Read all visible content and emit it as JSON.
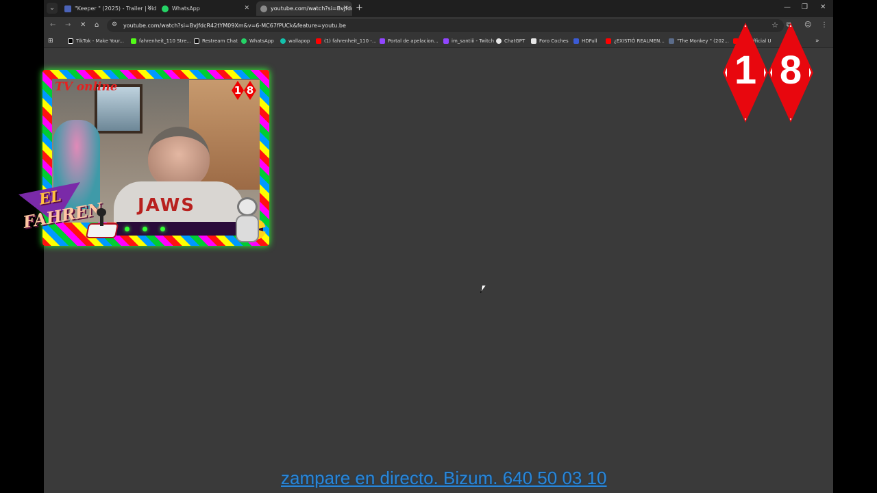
{
  "browser": {
    "tabs": [
      {
        "label": "\"Keeper \" (2025) - Trailer | vide",
        "favicon": "hdfull-icon",
        "active": false
      },
      {
        "label": "WhatsApp",
        "favicon": "whatsapp-icon",
        "active": false
      },
      {
        "label": "youtube.com/watch?si=BvJfdc",
        "favicon": "loading-icon",
        "active": true
      }
    ],
    "url": "youtube.com/watch?si=BvJfdcR42tYM09Xm&v=6-MC67fPUCk&feature=youtu.be",
    "bookmarks": [
      {
        "label": "TikTok - Make Your...",
        "color": "#000000"
      },
      {
        "label": "fahrenheit_110 Stre...",
        "color": "#53fc18"
      },
      {
        "label": "Restream Chat",
        "color": "#111111"
      },
      {
        "label": "WhatsApp",
        "color": "#25d366"
      },
      {
        "label": "wallapop",
        "color": "#13c1ac"
      },
      {
        "label": "(1) fahrenheit_110 -...",
        "color": "#ff0000"
      },
      {
        "label": "Portal de apelacion...",
        "color": "#9146ff"
      },
      {
        "label": "im_santiii - Twitch",
        "color": "#9146ff"
      },
      {
        "label": "ChatGPT",
        "color": "#e6e6e6"
      },
      {
        "label": "Foro Coches",
        "color": "#e6e6e6"
      },
      {
        "label": "HDFull",
        "color": "#3b5bd6"
      },
      {
        "label": "¿EXISTIÓ REALMEN...",
        "color": "#ff0000"
      },
      {
        "label": "\"The Monkey \" (202...",
        "color": "#5b6c8a"
      },
      {
        "label": "EN Official U",
        "color": "#ff0000"
      }
    ]
  },
  "overlay": {
    "cam_title": "TV online",
    "badge_digits": [
      "1",
      "8"
    ],
    "shirt_text": "JAWS",
    "logo_line1": "EL",
    "logo_line2": "FAHREN",
    "age_rating": [
      "1",
      "8"
    ],
    "ticker": "zampare en directo. Bizum. 640 50 03 10",
    "accent_color": "#e8070e",
    "ticker_color": "#2a86d8"
  }
}
